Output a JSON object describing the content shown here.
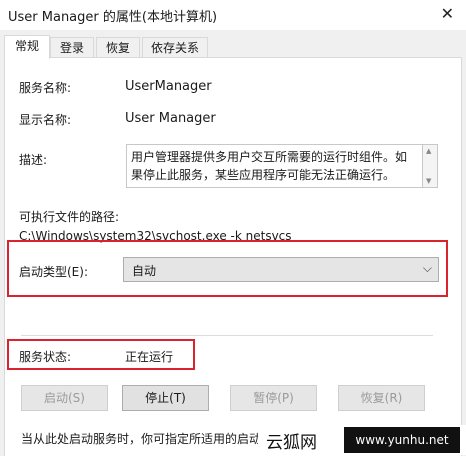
{
  "window": {
    "title": "User Manager 的属性(本地计算机)",
    "close_symbol": "✕"
  },
  "tabs": [
    {
      "label": "常规",
      "active": true
    },
    {
      "label": "登录",
      "active": false
    },
    {
      "label": "恢复",
      "active": false
    },
    {
      "label": "依存关系",
      "active": false
    }
  ],
  "general": {
    "service_name_label": "服务名称:",
    "service_name_value": "UserManager",
    "display_name_label": "显示名称:",
    "display_name_value": "User Manager",
    "description_label": "描述:",
    "description_value": "用户管理器提供多用户交互所需要的运行时组件。如果停止此服务，某些应用程序可能无法正确运行。",
    "exe_path_label": "可执行文件的路径:",
    "exe_path_value": "C:\\Windows\\system32\\svchost.exe -k netsvcs",
    "startup_type_label": "启动类型(E):",
    "startup_type_value": "自动",
    "status_label": "服务状态:",
    "status_value": "正在运行"
  },
  "buttons": {
    "start": "启动(S)",
    "stop": "停止(T)",
    "pause": "暂停(P)",
    "resume": "恢复(R)"
  },
  "hint": "当从此处启动服务时，你可指定所适用的启动",
  "watermark": {
    "cn": "云狐网",
    "url": "www.yunhu.net"
  },
  "colors": {
    "highlight_box": "#d9232d"
  }
}
